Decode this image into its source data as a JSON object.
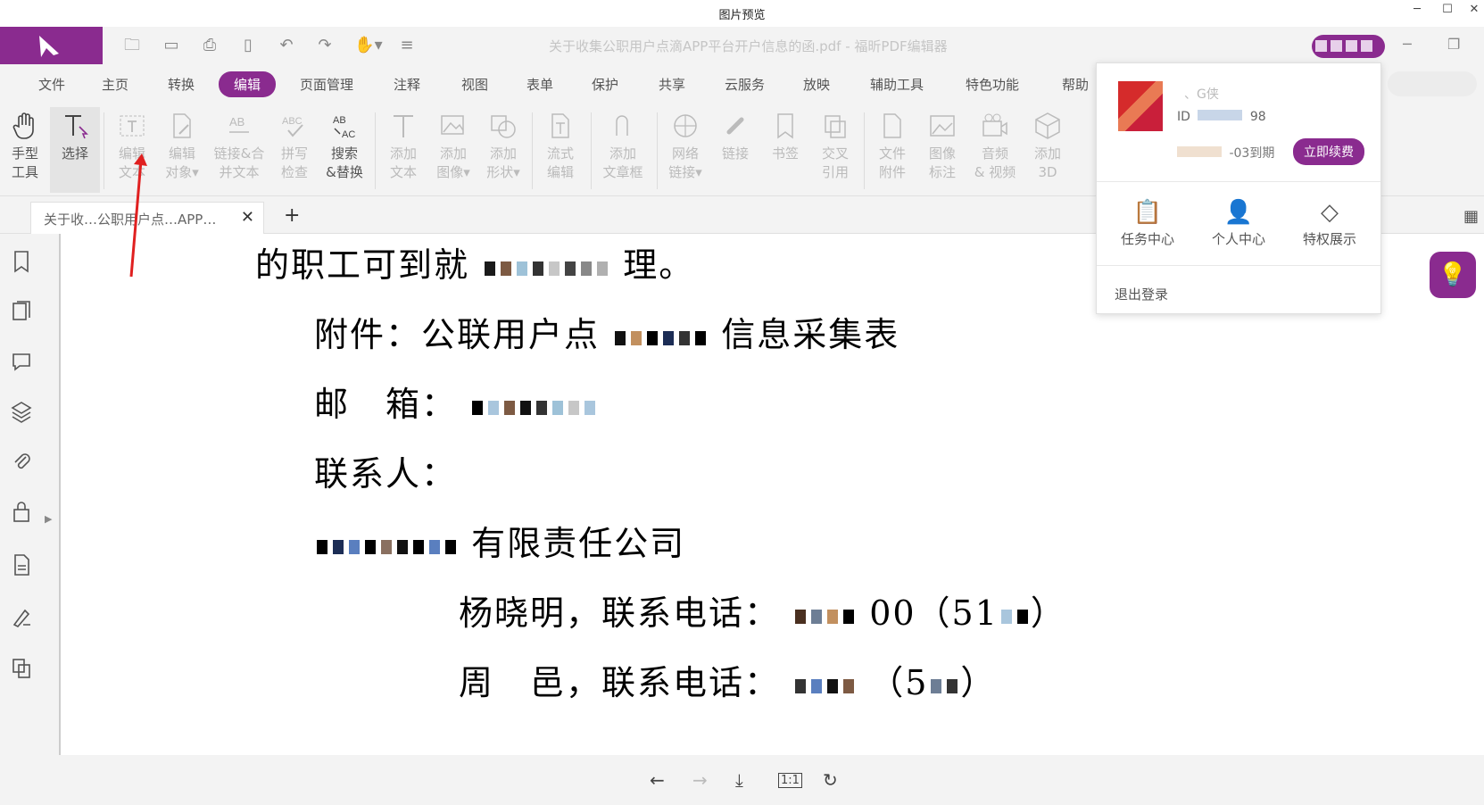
{
  "window": {
    "title": "图片预览",
    "minimize": "─",
    "maximize": "☐",
    "close": "✕"
  },
  "app": {
    "doc_title": "关于收集公职用户点滴APP平台开户信息的函.pdf - 福昕PDF编辑器",
    "accent": "#8a2b8f"
  },
  "menu": [
    "文件",
    "主页",
    "转换",
    "编辑",
    "页面管理",
    "注释",
    "视图",
    "表单",
    "保护",
    "共享",
    "云服务",
    "放映",
    "辅助工具",
    "特色功能",
    "帮助"
  ],
  "menu_active": "编辑",
  "ribbon": [
    {
      "label": "手型\n工具",
      "icon": "hand-icon",
      "enabled": true
    },
    {
      "label": "选择",
      "icon": "select-text-icon",
      "enabled": true,
      "selected": true
    },
    {
      "label": "编辑\n文本",
      "icon": "edit-text-icon",
      "enabled": false
    },
    {
      "label": "编辑\n对象▾",
      "icon": "edit-object-icon",
      "enabled": false
    },
    {
      "label": "链接&合\n并文本",
      "icon": "link-merge-icon",
      "enabled": false
    },
    {
      "label": "拼写\n检查",
      "icon": "spell-check-icon",
      "enabled": false
    },
    {
      "label": "搜索\n&替换",
      "icon": "search-replace-icon",
      "enabled": true
    },
    {
      "label": "添加\n文本",
      "icon": "add-text-icon",
      "enabled": false
    },
    {
      "label": "添加\n图像▾",
      "icon": "add-image-icon",
      "enabled": false
    },
    {
      "label": "添加\n形状▾",
      "icon": "add-shape-icon",
      "enabled": false
    },
    {
      "label": "流式\n编辑",
      "icon": "flow-edit-icon",
      "enabled": false
    },
    {
      "label": "添加\n文章框",
      "icon": "article-box-icon",
      "enabled": false
    },
    {
      "label": "网络\n链接▾",
      "icon": "web-link-icon",
      "enabled": false
    },
    {
      "label": "链接",
      "icon": "link-icon",
      "enabled": false
    },
    {
      "label": "书签",
      "icon": "bookmark-icon",
      "enabled": false
    },
    {
      "label": "交叉\n引用",
      "icon": "cross-ref-icon",
      "enabled": false
    },
    {
      "label": "文件\n附件",
      "icon": "file-attach-icon",
      "enabled": false
    },
    {
      "label": "图像\n标注",
      "icon": "image-annot-icon",
      "enabled": false
    },
    {
      "label": "音频\n& 视频",
      "icon": "media-icon",
      "enabled": false
    },
    {
      "label": "添加\n3D",
      "icon": "3d-icon",
      "enabled": false
    }
  ],
  "tab": {
    "label": "关于收…公职用户点…APP…",
    "close": "✕",
    "add": "+"
  },
  "popup": {
    "name": "、G侠",
    "id_label": "ID",
    "id_value": "98",
    "expire": "-03到期",
    "renew": "立即续费",
    "items": [
      "任务中心",
      "个人中心",
      "特权展示"
    ],
    "logout": "退出登录"
  },
  "document": {
    "lines": [
      {
        "text": "的职工可到就",
        "tail": "理。"
      },
      {
        "text": "附件：公联用户点",
        "tail": "信息采集表"
      },
      {
        "text": "邮　箱：",
        "tail": ""
      },
      {
        "text": "联系人：",
        "tail": ""
      },
      {
        "text": "",
        "tail": "有限责任公司"
      },
      {
        "text": "杨晓明，联系电话：",
        "tail": "00（51",
        "tail2": "）"
      },
      {
        "text": "周　邑，联系电话：",
        "tail": "（5",
        "tail2": "）"
      }
    ]
  },
  "bottom": {
    "prev": "←",
    "next": "→",
    "download": "⤓",
    "actual": "1:1",
    "rotate": "↻"
  }
}
